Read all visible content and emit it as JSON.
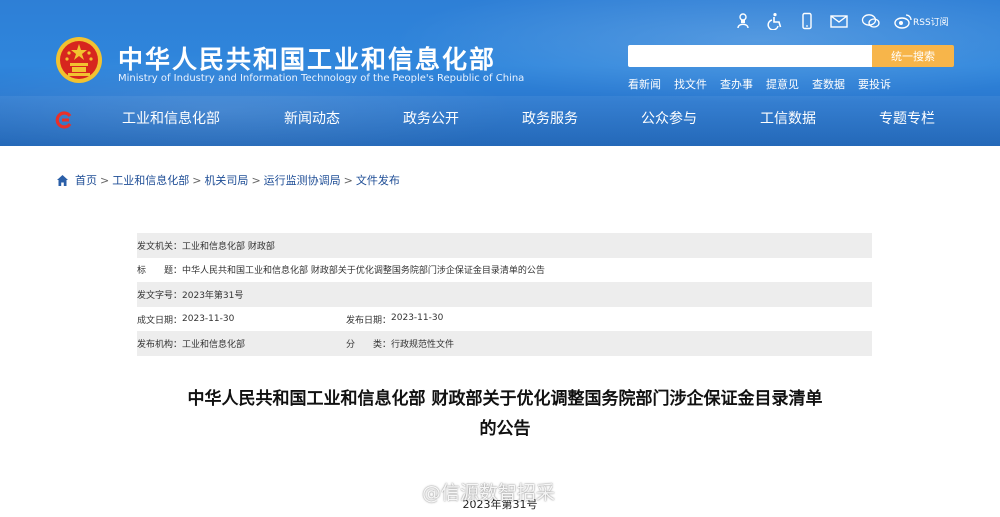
{
  "header": {
    "title_cn": "中华人民共和国工业和信息化部",
    "title_en": "Ministry of Industry and Information Technology of the People's Republic of China",
    "util_icons": [
      "accessibility-person-icon",
      "wheelchair-icon",
      "mobile-phone-icon",
      "mail-icon",
      "wechat-icon",
      "weibo-icon"
    ],
    "rss_label": "RSS订阅",
    "search": {
      "placeholder": "",
      "button_label": "统一搜索"
    },
    "quick_links": [
      "看新闻",
      "找文件",
      "查办事",
      "提意见",
      "查数据",
      "要投诉"
    ]
  },
  "nav": {
    "items": [
      "工业和信息化部",
      "新闻动态",
      "政务公开",
      "政务服务",
      "公众参与",
      "工信数据",
      "专题专栏"
    ]
  },
  "breadcrumb": [
    "首页",
    "工业和信息化部",
    "机关司局",
    "运行监测协调局",
    "文件发布"
  ],
  "meta": {
    "issuer_label": "发文机关：",
    "issuer_value": "工业和信息化部 财政部",
    "title_label": "标　　题：",
    "title_value": "中华人民共和国工业和信息化部 财政部关于优化调整国务院部门涉企保证金目录清单的公告",
    "doc_no_label": "发文字号：",
    "doc_no_value": "2023年第31号",
    "created_label": "成文日期：",
    "created_value": "2023-11-30",
    "published_label": "发布日期：",
    "published_value": "2023-11-30",
    "publisher_label": "发布机构：",
    "publisher_value": "工业和信息化部",
    "category_label": "分　　类：",
    "category_value": "行政规范性文件"
  },
  "document": {
    "title_line1": "中华人民共和国工业和信息化部 财政部关于优化调整国务院部门涉企保证金目录清单",
    "title_line2": "的公告",
    "number": "2023年第31号"
  },
  "watermark": "@信源数智招采",
  "colors": {
    "header_blue": "#2e7fd6",
    "search_button": "#f7b54a",
    "emblem_red": "#d7261e",
    "emblem_gold": "#f2c230",
    "link_blue": "#1f4e96",
    "meta_shade": "#ededed"
  }
}
